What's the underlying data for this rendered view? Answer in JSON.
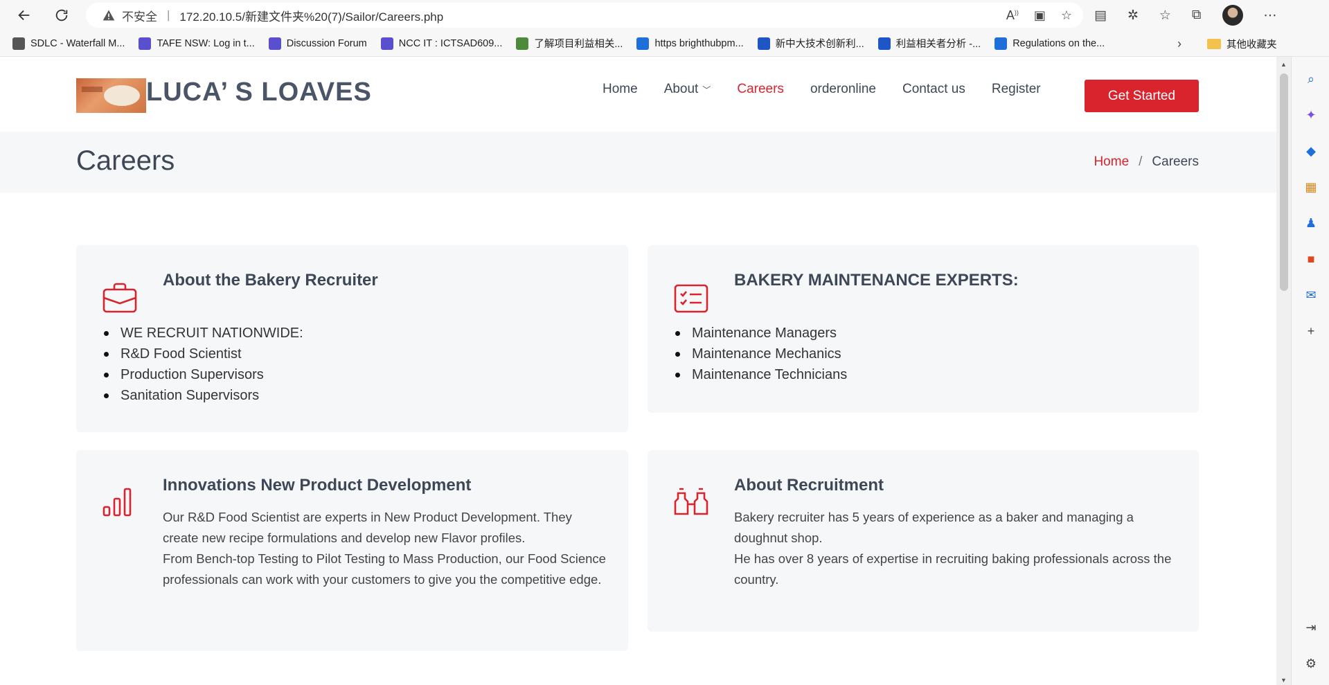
{
  "browser": {
    "insecure_label": "不安全",
    "url": "172.20.10.5/新建文件夹%20(7)/Sailor/Careers.php",
    "bookmarks": [
      {
        "label": "SDLC - Waterfall M...",
        "icon": "sdlc-icon",
        "color": "#555555"
      },
      {
        "label": "TAFE NSW: Log in t...",
        "icon": "tafe-icon",
        "color": "#5a4fcf"
      },
      {
        "label": "Discussion Forum",
        "icon": "forum-icon",
        "color": "#5a4fcf"
      },
      {
        "label": "NCC IT : ICTSAD609...",
        "icon": "ncc-icon",
        "color": "#5a4fcf"
      },
      {
        "label": "了解项目利益相关...",
        "icon": "project-icon",
        "color": "#4e8a3c"
      },
      {
        "label": "https brighthubpm...",
        "icon": "bing-icon",
        "color": "#1e6fd9"
      },
      {
        "label": "新中大技术创新利...",
        "icon": "m-icon",
        "color": "#1e56c8"
      },
      {
        "label": "利益相关者分析 -...",
        "icon": "m-icon",
        "color": "#1e56c8"
      },
      {
        "label": "Regulations on the...",
        "icon": "search-icon",
        "color": "#1e6fd9"
      }
    ],
    "other_bookmarks": "其他收藏夹"
  },
  "site": {
    "logo_text": "LUCA’ S LOAVES",
    "nav": [
      {
        "label": "Home",
        "active": false
      },
      {
        "label": "About",
        "active": false,
        "dropdown": true
      },
      {
        "label": "Careers",
        "active": true
      },
      {
        "label": "orderonline",
        "active": false
      },
      {
        "label": "Contact us",
        "active": false
      },
      {
        "label": "Register",
        "active": false
      }
    ],
    "cta": "Get Started",
    "accent_color": "#d9232d"
  },
  "banner": {
    "title": "Careers",
    "breadcrumb_home": "Home",
    "breadcrumb_sep": "/",
    "breadcrumb_current": "Careers"
  },
  "cards": [
    {
      "icon": "briefcase-icon",
      "title": "About the Bakery Recruiter",
      "items": [
        "WE RECRUIT NATIONWIDE:",
        "R&D Food Scientist",
        "Production Supervisors",
        "Sanitation Supervisors"
      ]
    },
    {
      "icon": "checklist-icon",
      "title": "BAKERY MAINTENANCE EXPERTS:",
      "items": [
        "Maintenance Managers",
        "Maintenance Mechanics",
        "Maintenance Technicians"
      ]
    },
    {
      "icon": "bar-chart-icon",
      "title": "Innovations New Product Development",
      "paragraphs": [
        "Our R&D Food Scientist are experts in New Product Development. They create new recipe formulations and develop new Flavor profiles.",
        "From Bench-top Testing to Pilot Testing to Mass Production, our Food Science professionals can work with your customers to give you the competitive edge."
      ]
    },
    {
      "icon": "binoculars-icon",
      "title": "About Recruitment",
      "paragraphs": [
        "Bakery recruiter has 5 years of experience as a baker and managing a doughnut shop.",
        "He has over 8 years of expertise in recruiting baking professionals across the country."
      ]
    }
  ]
}
